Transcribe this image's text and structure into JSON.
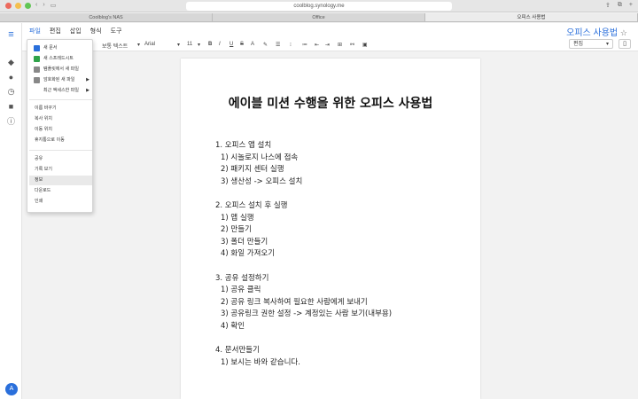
{
  "browser": {
    "url": "coolblog.synology.me",
    "tabs": [
      "Coolblog's NAS",
      "Office",
      "오피스 사용법"
    ]
  },
  "app": {
    "menu": [
      "파일",
      "편집",
      "삽입",
      "형식",
      "도구"
    ],
    "doc_title": "오피스 사용법",
    "star_icon": "star-icon",
    "user_initial": "A"
  },
  "toolbar": {
    "style": "보통 텍스트",
    "font": "Arial",
    "size": "11",
    "view_mode": "편집"
  },
  "file_menu": {
    "items": [
      {
        "label": "새 문서",
        "icon_color": "#2a6fdb"
      },
      {
        "label": "새 스프레드시트",
        "icon_color": "#2fa34a"
      },
      {
        "label": "템플릿에서 새 파일",
        "icon_color": "#777777"
      },
      {
        "label": "암호화된 새 파일",
        "icon_color": "#777777",
        "submenu": true
      },
      {
        "label": "최근 액세스한 파일",
        "submenu": true
      },
      {
        "label": "이름 바꾸기"
      },
      {
        "label": "복사 위치"
      },
      {
        "label": "이동 위치"
      },
      {
        "label": "휴지통으로 이동"
      },
      {
        "label": "공유"
      },
      {
        "label": "기록 보기"
      },
      {
        "label": "정보",
        "selected": true
      },
      {
        "label": "다운로드"
      },
      {
        "label": "인쇄"
      }
    ]
  },
  "document": {
    "title": "에이블 미션 수행을 위한 오피스 사용법",
    "sections": [
      {
        "heading": "1. 오피스 앱 설치",
        "items": [
          "1) 시놀로지 나스에 접속",
          "2) 패키지 센터 실행",
          "3) 생산성 -> 오피스 설치"
        ]
      },
      {
        "heading": "2. 오피스 설치 후 실행",
        "items": [
          "1) 앱 실행",
          "2) 만들기",
          "3) 폴더 만들기",
          "4) 화일 가져오기"
        ]
      },
      {
        "heading": "3. 공유 설정하기",
        "items": [
          "1) 공유 클릭",
          "2) 공유 링크 복사하여 필요한 사람에게 보내기",
          "3) 공유링크 권한 설정 -> 계정있는 사람 보기(내부용)",
          "4) 확인"
        ]
      },
      {
        "heading": "4. 문서만들기",
        "items": [
          "1) 보시는 바와 같습니다."
        ]
      }
    ]
  }
}
